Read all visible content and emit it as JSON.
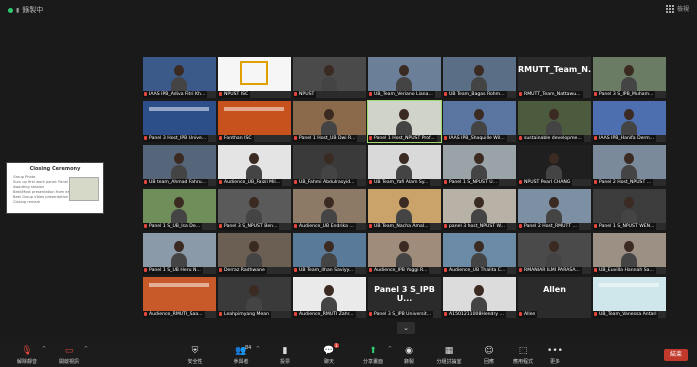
{
  "top": {
    "recording_label": "錄製中",
    "view_label": "檢視"
  },
  "shared_screen": {
    "title": "Closing Ceremony",
    "items": [
      "Group Photo",
      "Sum up first work panel: Panel for 3 menu",
      "Awarding session",
      "Best/Most presentation from each panel",
      "Best Group Video presentation",
      "Closing remark"
    ]
  },
  "tiles": [
    {
      "label": "IAAS IPB_Adiva Fitri Kh...",
      "bg": "#3b5a8a",
      "kind": "person"
    },
    {
      "label": "NPUST ISC",
      "bg": "#f6f6f6",
      "kind": "logo"
    },
    {
      "label": "NPUST",
      "bg": "#4a4a4a",
      "kind": "person"
    },
    {
      "label": "UB_Team_Veriano Liana...",
      "bg": "#6b7f99",
      "kind": "person"
    },
    {
      "label": "UB Team_Bagas Rohm...",
      "bg": "#5a6e85",
      "kind": "person"
    },
    {
      "label": "RMUTT_Team_Nattawu...",
      "bg": "#2b2b2b",
      "kind": "text",
      "big": "RMUTT_Team_N..."
    },
    {
      "label": "Panel 3 S_IPB_Muham...",
      "bg": "#6a7d64",
      "kind": "person"
    },
    {
      "label": "Panel 3 Host_IPB Unive...",
      "bg": "#2c4f8a",
      "kind": "slide"
    },
    {
      "label": "Fonthan ISC",
      "bg": "#c8521e",
      "kind": "slide"
    },
    {
      "label": "Panel 1 Host_UB Dwi R...",
      "bg": "#8a6a4a",
      "kind": "person"
    },
    {
      "label": "Panel 1 Host_NPUST Prof...",
      "bg": "#cfd3c9",
      "kind": "person",
      "active": true
    },
    {
      "label": "IAAS IPB_Shaquille Wil...",
      "bg": "#5a76a0",
      "kind": "person"
    },
    {
      "label": "sustainable developme...",
      "bg": "#4c5a3e",
      "kind": "person"
    },
    {
      "label": "IAAS IPB_Hanifa Derm...",
      "bg": "#4d6fb0",
      "kind": "person"
    },
    {
      "label": "UB team_Ahmad Fahru...",
      "bg": "#55667a",
      "kind": "person"
    },
    {
      "label": "Audience_UB_Faizil Mil...",
      "bg": "#e4e4e4",
      "kind": "person"
    },
    {
      "label": "UB_Fahmi Abdulrasyid...",
      "bg": "#3a3a3a",
      "kind": "person"
    },
    {
      "label": "UB Team_Yafi Alam Sy...",
      "bg": "#d9d9d9",
      "kind": "person"
    },
    {
      "label": "Panel 1 S_NPUST U...",
      "bg": "#9aa3a8",
      "kind": "person"
    },
    {
      "label": "NPUST Pearl CHANG",
      "bg": "#1f1f1f",
      "kind": "person"
    },
    {
      "label": "Panel 2 Host_NPUST ...",
      "bg": "#7a8a9a",
      "kind": "person"
    },
    {
      "label": "Panel 1 S_UB_Isa De...",
      "bg": "#6f8e5a",
      "kind": "person"
    },
    {
      "label": "Panel 3 S_NPUST Ben...",
      "bg": "#5a5a5a",
      "kind": "person"
    },
    {
      "label": "Audience_UB Endrika ...",
      "bg": "#8c7a66",
      "kind": "person"
    },
    {
      "label": "UB Team_Nacha Amal...",
      "bg": "#c9a36a",
      "kind": "person"
    },
    {
      "label": "panel 3 host_NPUST W...",
      "bg": "#b8b2a6",
      "kind": "person"
    },
    {
      "label": "Panel 2 Host_RMUTT ...",
      "bg": "#7c8fa3",
      "kind": "person"
    },
    {
      "label": "Panel 1 S_NPUST WEN...",
      "bg": "#3c3c3c",
      "kind": "person"
    },
    {
      "label": "Panel 1 S_UB Heru N...",
      "bg": "#8a9aa8",
      "kind": "person"
    },
    {
      "label": "Derraz Radhwane",
      "bg": "#6b5e52",
      "kind": "person"
    },
    {
      "label": "UB Team_Ilhan Saviyy...",
      "bg": "#5a7a9a",
      "kind": "person"
    },
    {
      "label": "Audience_IPB Yoggi R...",
      "bg": "#a08c7a",
      "kind": "person"
    },
    {
      "label": "Audience_UB Thalita C...",
      "bg": "#6a8aa6",
      "kind": "person"
    },
    {
      "label": "RMANIAR ILMI PARASA...",
      "bg": "#4a4a4a",
      "kind": "person"
    },
    {
      "label": "UB_Euvilla Hannah Sa...",
      "bg": "#9c8f84",
      "kind": "person"
    },
    {
      "label": "Audience_RMUTI_Saa...",
      "bg": "#c85a2a",
      "kind": "slide"
    },
    {
      "label": "Leahpimyang Mean",
      "bg": "#3a3a3a",
      "kind": "person"
    },
    {
      "label": "Audience_RMUTI Zahr...",
      "bg": "#eaeaea",
      "kind": "person"
    },
    {
      "label": "Panel 3 S_IPB Universit...",
      "bg": "#2b2b2b",
      "kind": "text",
      "big": "Panel 3 S_IPB U..."
    },
    {
      "label": "A1501211008Hendry ...",
      "bg": "#dcdcdc",
      "kind": "person"
    },
    {
      "label": "Allen",
      "bg": "#2b2b2b",
      "kind": "text",
      "big": "Allen"
    },
    {
      "label": "UB_Team_Vanessa Antari",
      "bg": "#cfe6ea",
      "kind": "slide"
    }
  ],
  "toolbar": [
    {
      "icon": "mic-off-icon",
      "glyph": "🎙",
      "label": "解除靜音",
      "caret": true
    },
    {
      "icon": "video-off-icon",
      "glyph": "▭",
      "label": "開啟視訊",
      "caret": true
    },
    {
      "icon": "security-icon",
      "glyph": "⛨",
      "label": "安全性"
    },
    {
      "icon": "participants-icon",
      "glyph": "👥",
      "label": "參與者",
      "count": "84",
      "caret": true
    },
    {
      "icon": "polls-icon",
      "glyph": "▮",
      "label": "投票"
    },
    {
      "icon": "chat-icon",
      "glyph": "💬",
      "label": "聊天",
      "badge": "1"
    },
    {
      "icon": "share-screen-icon",
      "glyph": "⬆",
      "label": "分享畫面",
      "caret": true,
      "accent": "#2ecc71"
    },
    {
      "icon": "record-icon",
      "glyph": "◉",
      "label": "錄製"
    },
    {
      "icon": "breakout-icon",
      "glyph": "▦",
      "label": "分組討論室"
    },
    {
      "icon": "reactions-icon",
      "glyph": "☺",
      "label": "回應"
    },
    {
      "icon": "apps-icon",
      "glyph": "⬚",
      "label": "應用程式"
    },
    {
      "icon": "more-icon",
      "glyph": "•••",
      "label": "更多"
    }
  ],
  "end_label": "結束"
}
